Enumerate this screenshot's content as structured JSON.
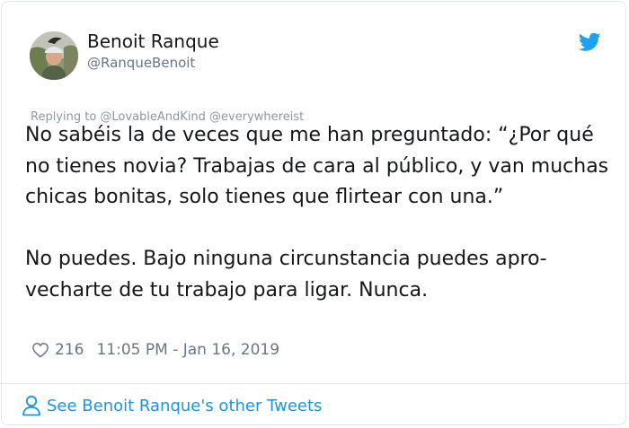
{
  "tweet": {
    "author_name": "Benoit Ranque",
    "author_handle": "@RanqueBenoit",
    "replying_to": "Replying to @LovableAndKind @everywhereist",
    "paragraphs": [
      "No sabéis la de veces que me han preguntado: “¿Por qué no tienes novia? Trabajas de cara al público, y van muchas chicas bonitas, solo tienes que flirtear con una.”",
      "No puedes. Bajo ninguna circunstancia puedes apro­vecharte de tu trabajo para ligar. Nunca."
    ],
    "likes": "216",
    "timestamp": "11:05 PM - Jan 16, 2019",
    "see_more": "See Benoit Ranque's other Tweets"
  },
  "icons": {
    "brand": "twitter-bird-icon",
    "like": "heart-icon",
    "profile": "person-icon"
  },
  "colors": {
    "brand_blue": "#1da1f2",
    "link_blue": "#1b95e0",
    "text": "#14171a",
    "muted": "#657786"
  }
}
